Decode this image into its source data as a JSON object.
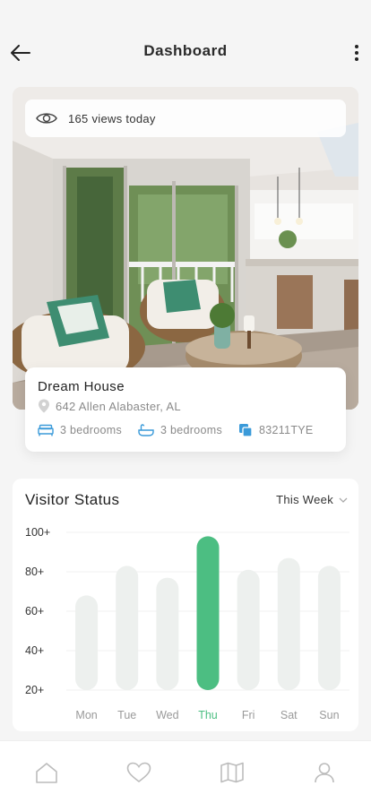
{
  "header": {
    "title": "Dashboard"
  },
  "hero": {
    "views_text": "165 views today"
  },
  "property": {
    "name": "Dream House",
    "address": "642 Allen Alabaster, AL",
    "features": [
      {
        "icon": "bed-icon",
        "label": "3 bedrooms"
      },
      {
        "icon": "bathtub-icon",
        "label": "3 bedrooms"
      },
      {
        "icon": "copy-icon",
        "label": "83211TYE"
      }
    ]
  },
  "visitor_status": {
    "title": "Visitor Status",
    "period": "This Week"
  },
  "colors": {
    "accent": "#4cbe82",
    "bar_inactive": "#edf0ee",
    "feature_icon": "#3a9ad9"
  },
  "chart_data": {
    "type": "bar",
    "categories": [
      "Mon",
      "Tue",
      "Wed",
      "Thu",
      "Fri",
      "Sat",
      "Sun"
    ],
    "values": [
      68,
      83,
      77,
      98,
      81,
      87,
      83
    ],
    "highlight": "Thu",
    "y_ticks": [
      "100+",
      "80+",
      "60+",
      "40+",
      "20+"
    ],
    "ylim": [
      20,
      100
    ],
    "grid": true
  },
  "tabbar": {
    "items": [
      {
        "icon": "home-icon"
      },
      {
        "icon": "heart-icon"
      },
      {
        "icon": "map-icon"
      },
      {
        "icon": "profile-icon"
      }
    ]
  }
}
